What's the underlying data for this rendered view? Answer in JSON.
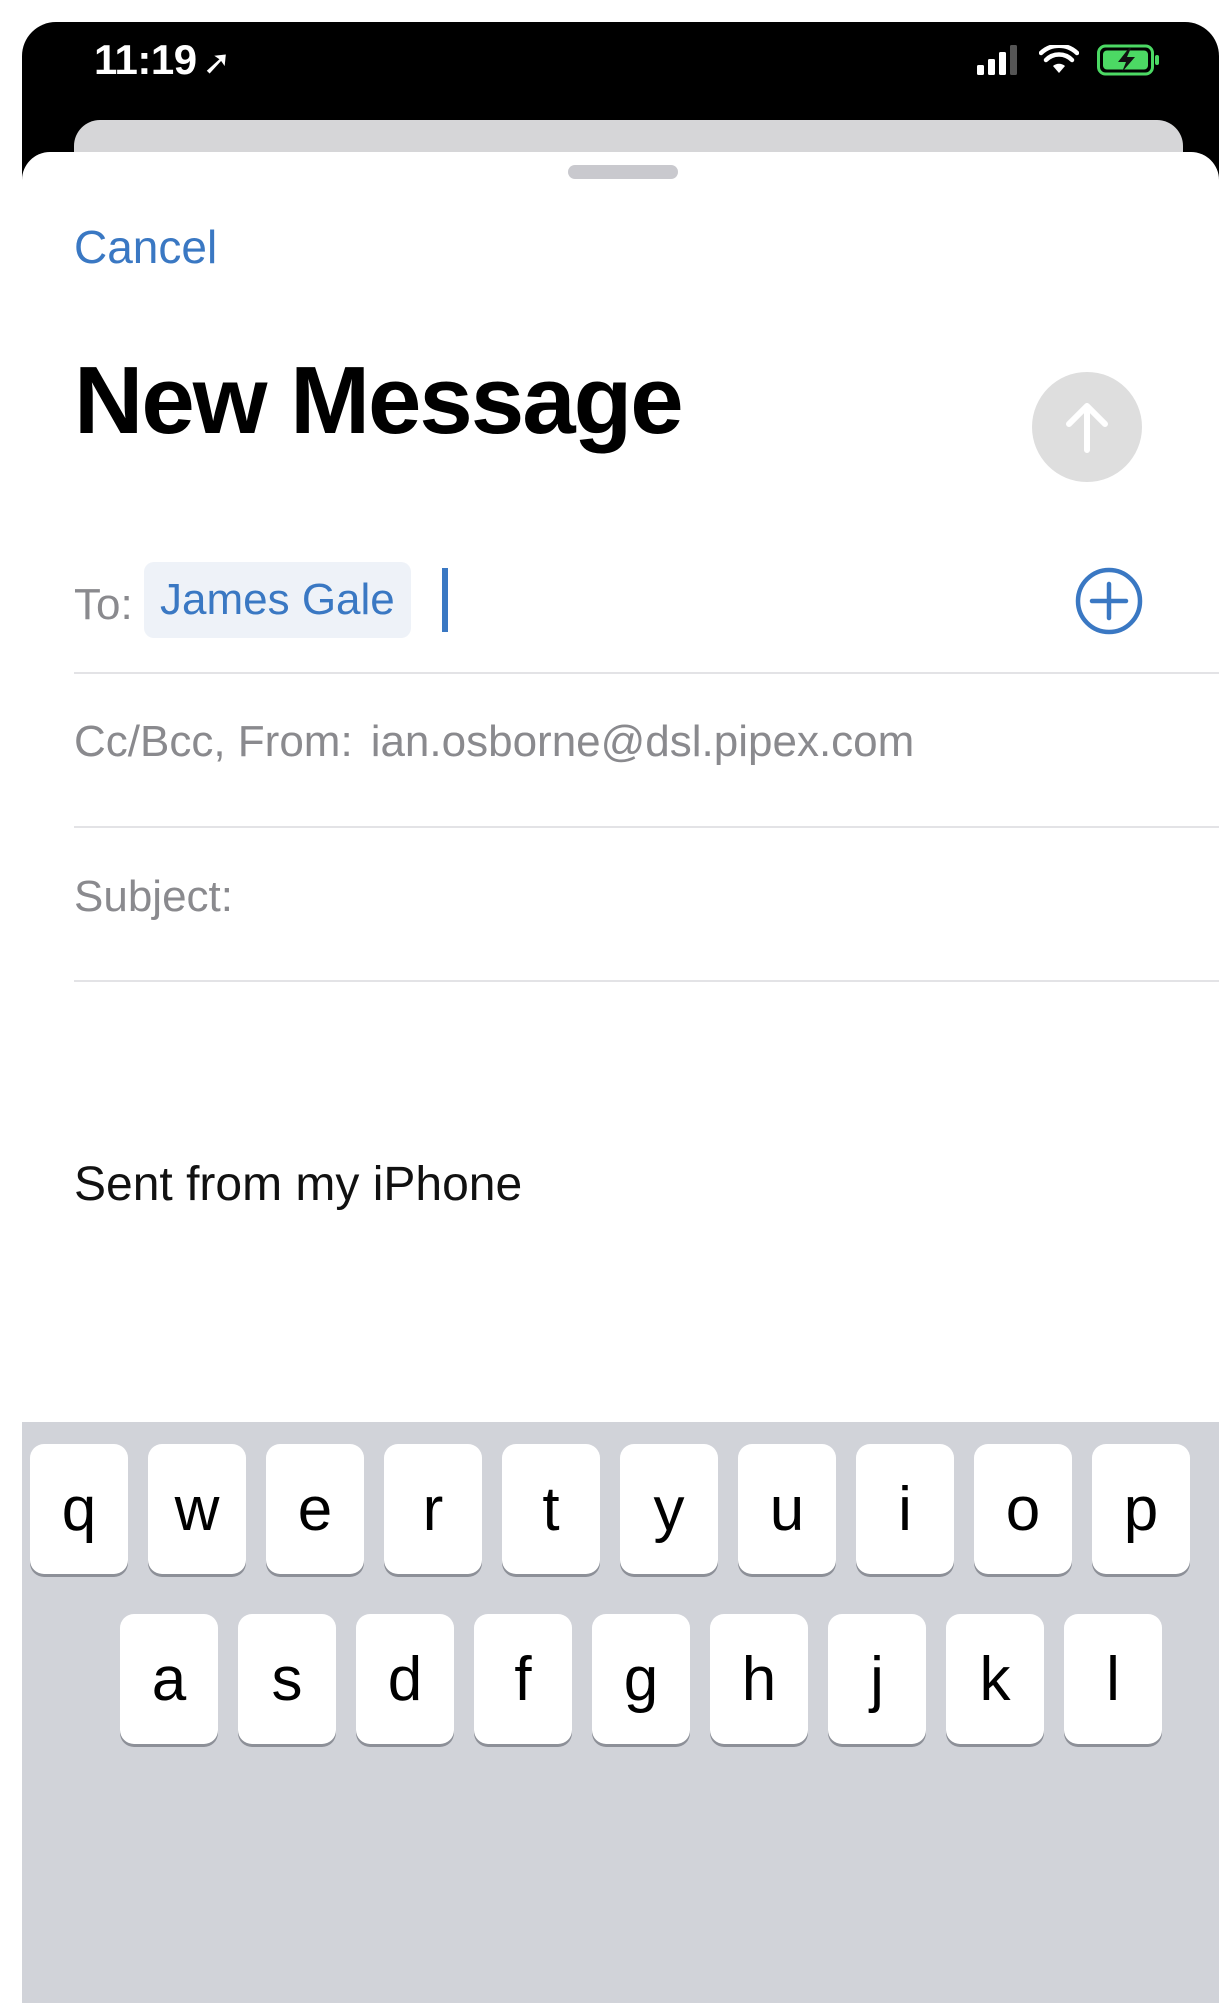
{
  "status_bar": {
    "time": "11:19",
    "location_arrow": "location-arrow-icon",
    "signal": "signal-bars-icon",
    "wifi": "wifi-icon",
    "battery": "battery-charging-icon",
    "battery_color": "#4cd964"
  },
  "compose": {
    "cancel_label": "Cancel",
    "title": "New Message",
    "send_icon": "arrow-up-icon",
    "to_label": "To:",
    "recipient": "James Gale",
    "add_contact_icon": "plus-circle-icon",
    "cc_from_label": "Cc/Bcc, From:",
    "from_email": "ian.osborne@dsl.pipex.com",
    "subject_label": "Subject:",
    "signature": "Sent from my iPhone"
  },
  "keyboard": {
    "row1": [
      "q",
      "w",
      "e",
      "r",
      "t",
      "y",
      "u",
      "i",
      "o",
      "p"
    ],
    "row2": [
      "a",
      "s",
      "d",
      "f",
      "g",
      "h",
      "j",
      "k",
      "l"
    ]
  },
  "colors": {
    "accent": "#3a78c3",
    "placeholder": "#8a8a8e",
    "keyboard_bg": "#d1d3d9"
  }
}
